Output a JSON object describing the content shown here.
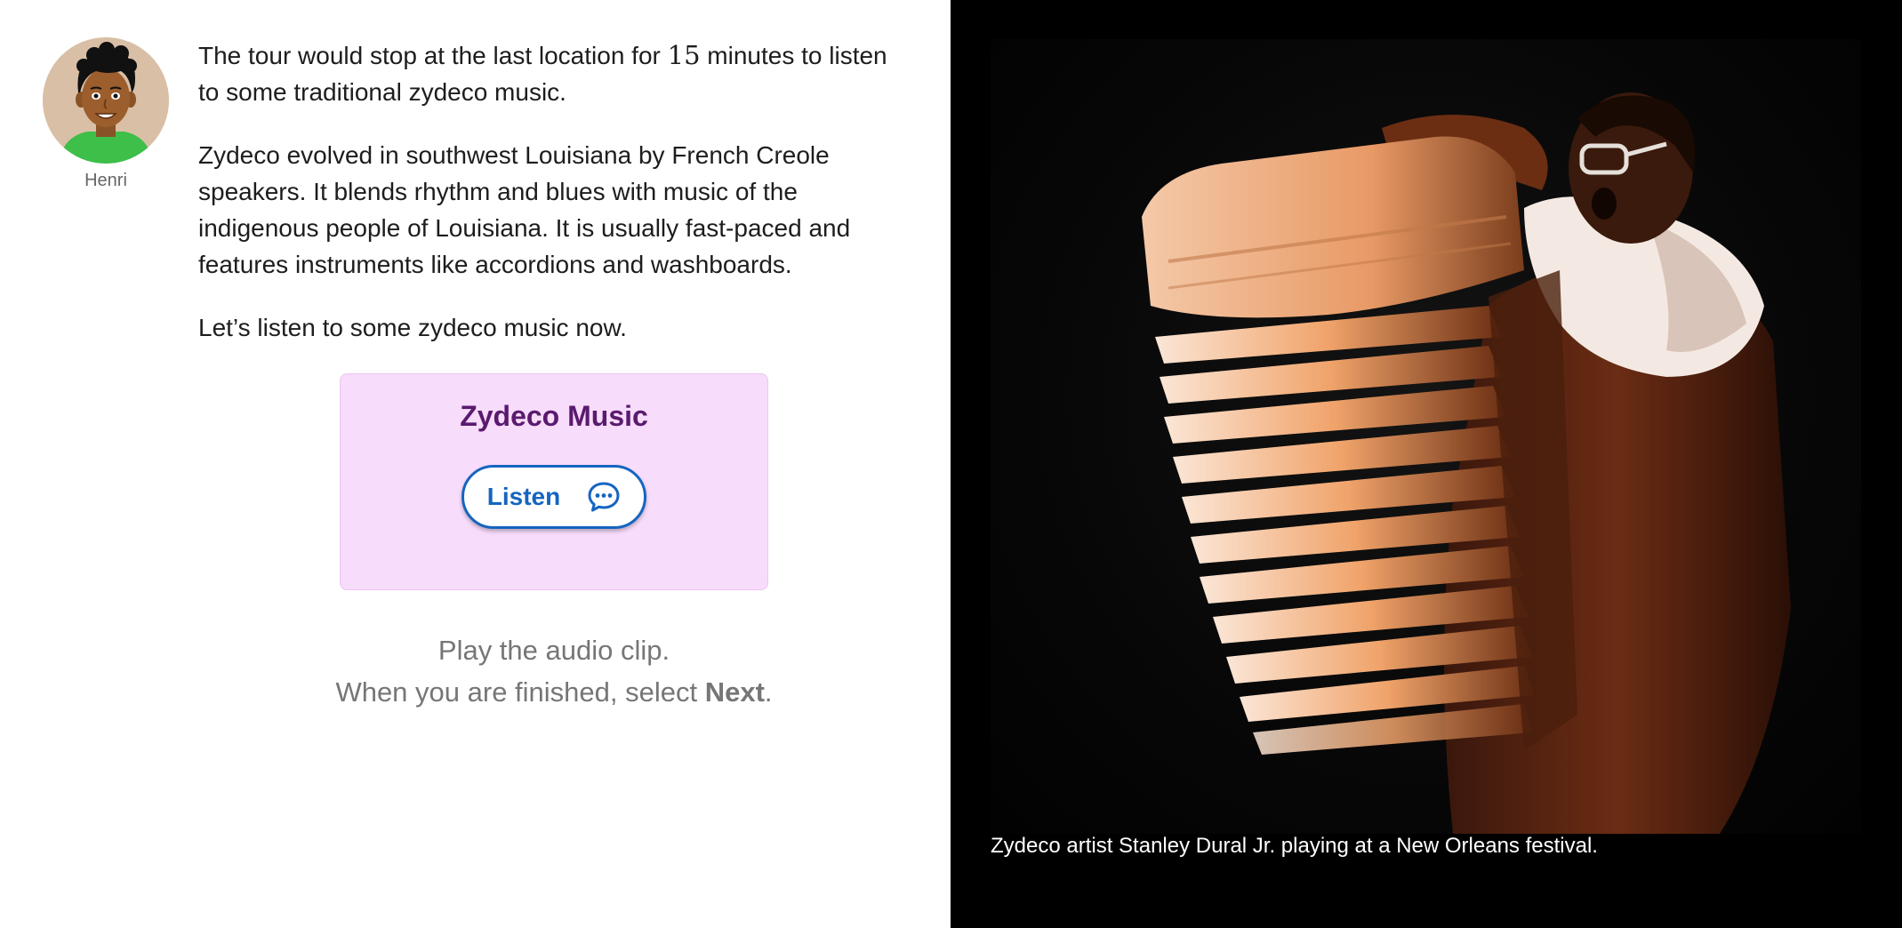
{
  "guide": {
    "name": "Henri",
    "avatar_icon": "person-avatar-icon"
  },
  "narration": {
    "paragraph1_before": "The tour would stop at the last location for ",
    "paragraph1_number": "15",
    "paragraph1_after": " minutes to listen to some traditional zydeco music.",
    "paragraph2": "Zydeco evolved in southwest Louisiana by French Creole speakers. It blends rhythm and blues with music of the indigenous people of Louisiana. It is usually fast-paced and features instruments like accordions and washboards.",
    "paragraph3": "Let’s listen to some zydeco music now."
  },
  "audio_card": {
    "title": "Zydeco Music",
    "button_label": "Listen",
    "button_icon": "chat-bubble-icon"
  },
  "instructions": {
    "line1": "Play the audio clip.",
    "line2_before": "When you are finished, select ",
    "line2_bold": "Next",
    "line2_after": "."
  },
  "image": {
    "caption": "Zydeco artist Stanley Dural Jr. playing at a New Orleans festival."
  },
  "colors": {
    "card_background": "#f7dcfb",
    "card_title": "#5a1a6e",
    "button_accent": "#1565c0",
    "image_panel": "#000000"
  }
}
